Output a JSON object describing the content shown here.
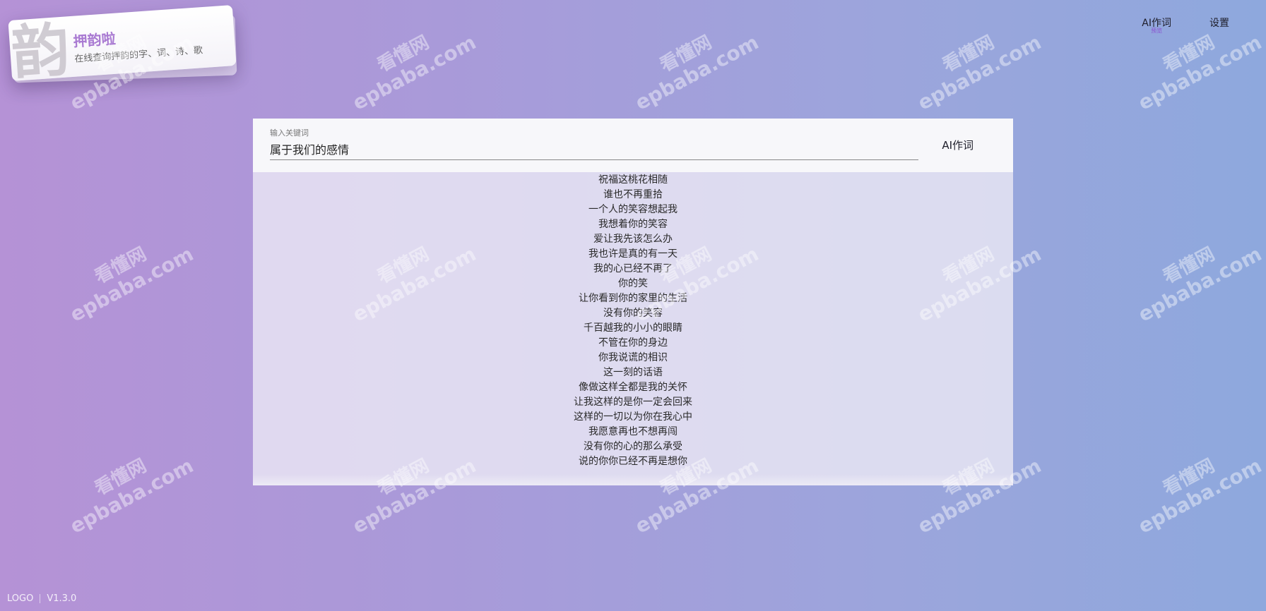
{
  "brand": {
    "glyph": "韵",
    "title": "押韵啦",
    "subtitle": "在线查询押韵的字、词、诗、歌"
  },
  "nav": {
    "ai_write": "AI作词",
    "ai_write_badge": "预览",
    "settings": "设置"
  },
  "search": {
    "label": "输入关键词",
    "value": "属于我们的感情",
    "button_label": "AI作词"
  },
  "lyrics": [
    "祝福这桃花相随",
    "谁也不再重拾",
    "一个人的笑容想起我",
    "我想着你的笑容",
    "爱让我先该怎么办",
    "我也许是真的有一天",
    "我的心已经不再了",
    "你的笑",
    "让你看到你的家里的生活",
    "没有你的笑容",
    "千百越我的小小的眼睛",
    "不管在你的身边",
    "你我说谎的相识",
    "这一刻的话语",
    "像做这样全都是我的关怀",
    "让我这样的是你一定会回来",
    "这样的一切以为你在我心中",
    "我愿意再也不想再闯",
    "没有你的心的那么承受",
    "说的你你已经不再是想你"
  ],
  "watermark": {
    "cn": "看懂网",
    "en": "epbaba.com"
  },
  "footer": {
    "logo": "LOGO",
    "version": "V1.3.0"
  }
}
